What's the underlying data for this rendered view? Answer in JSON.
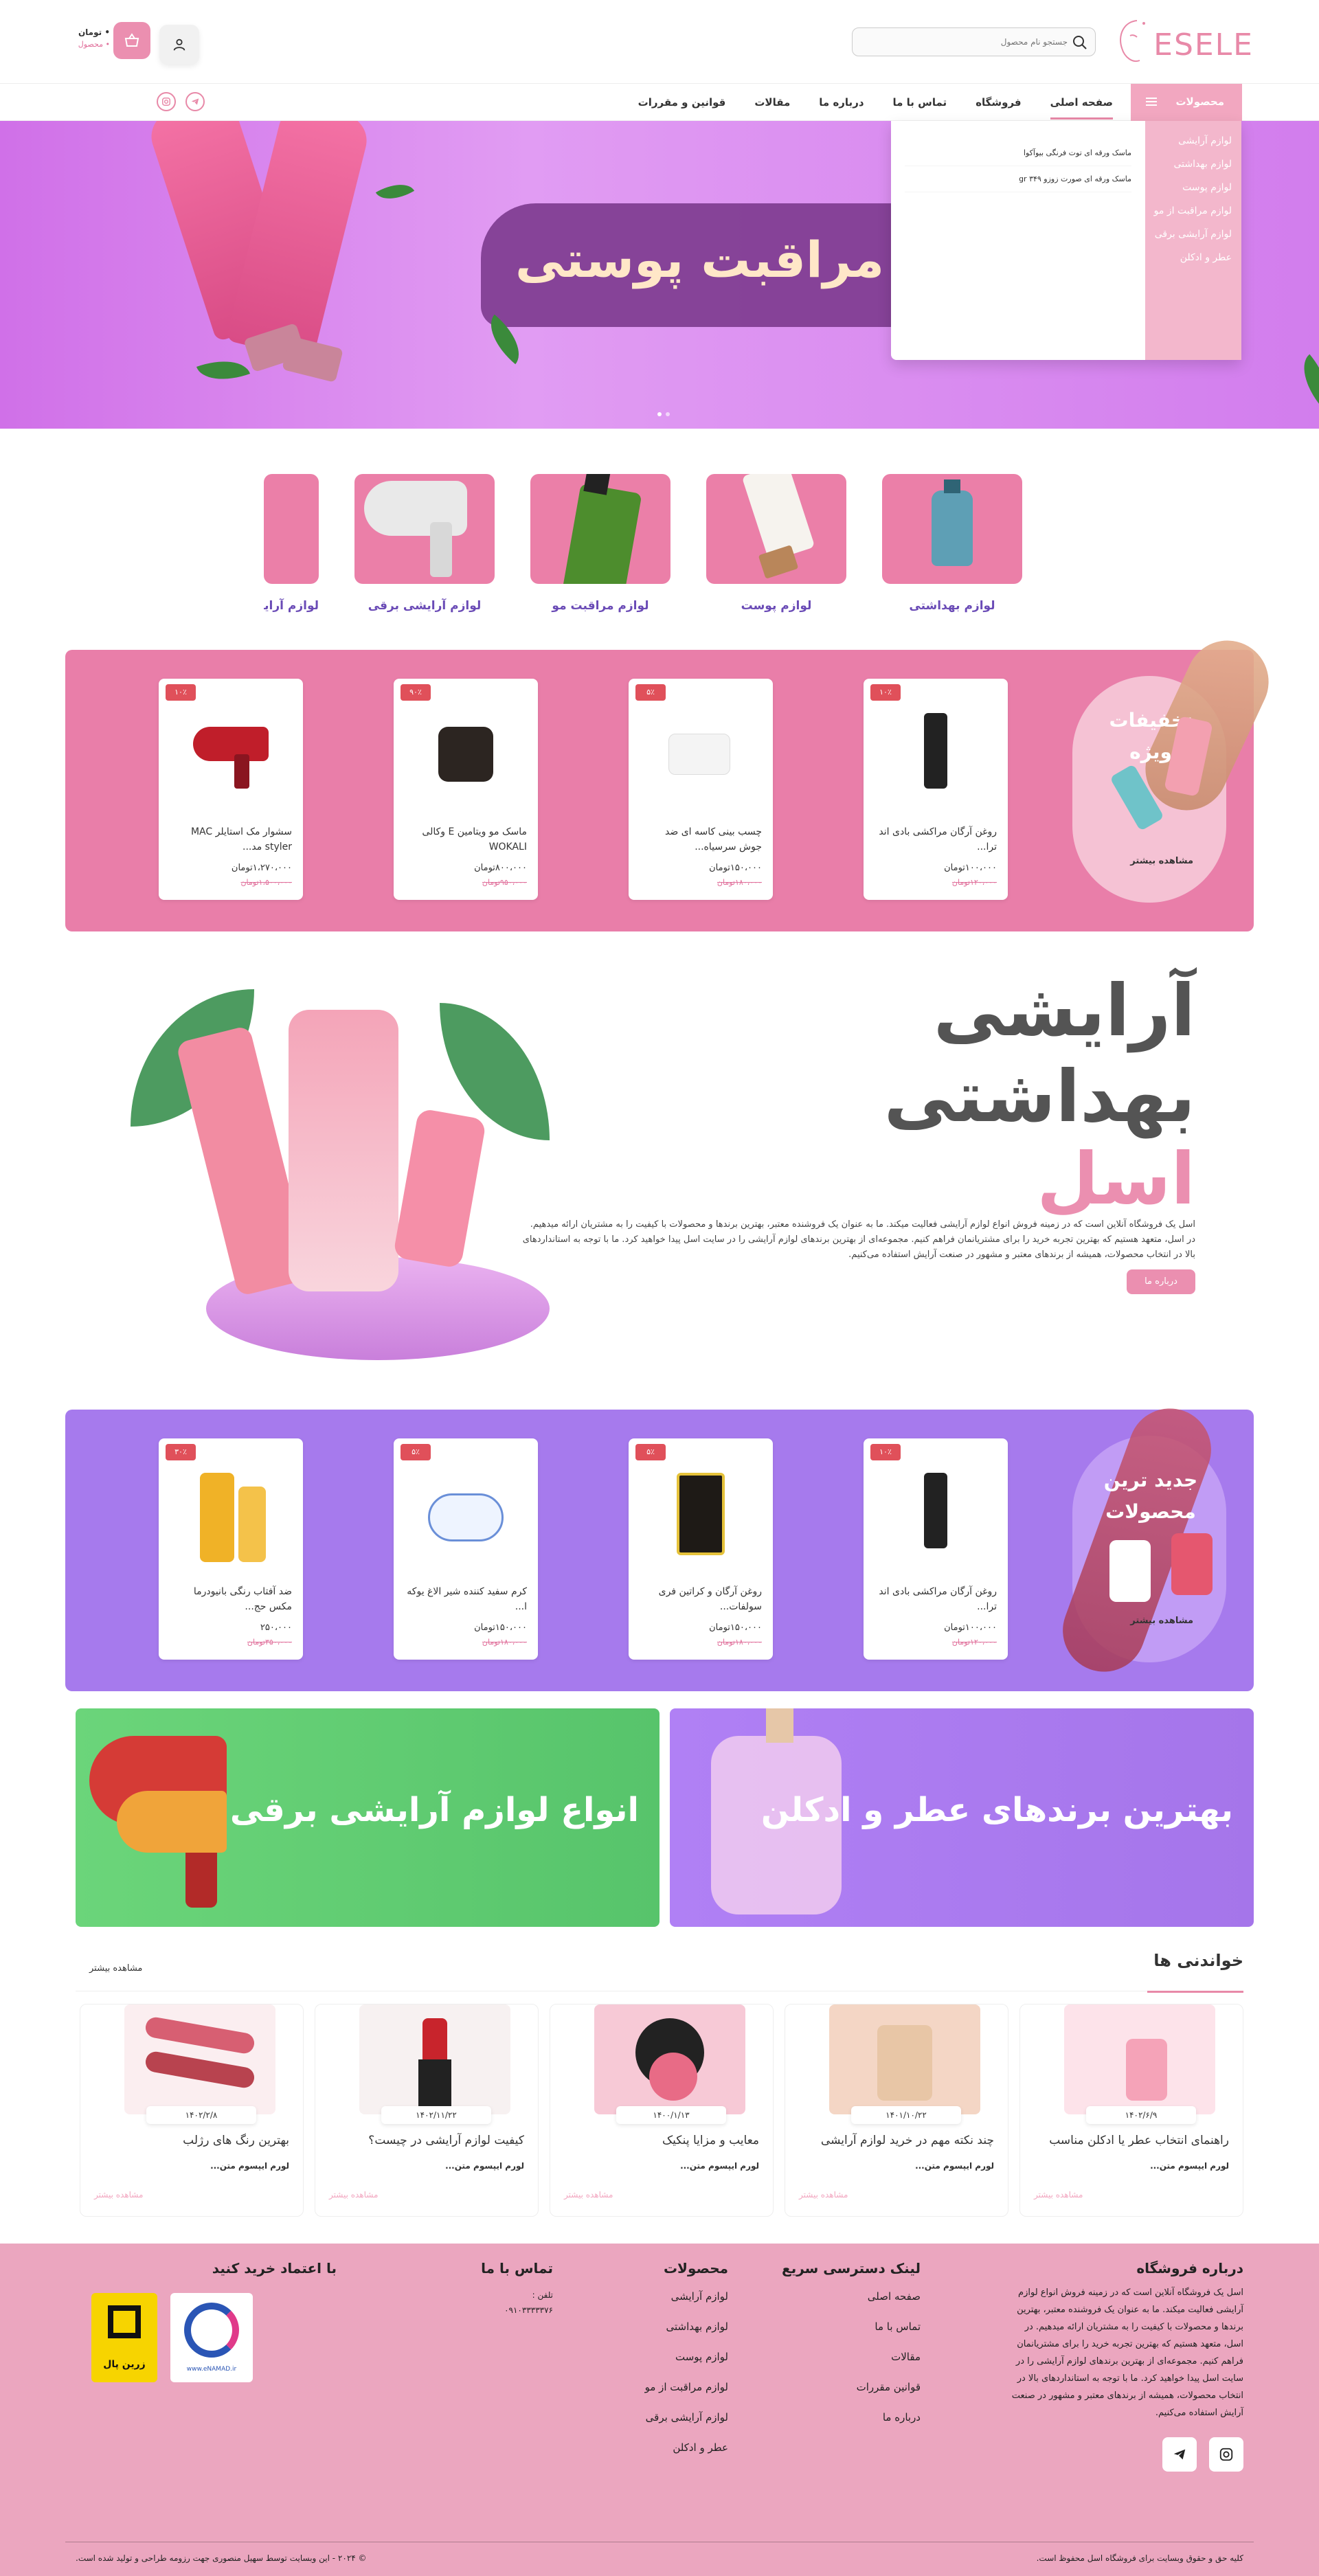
{
  "header": {
    "logo_text": "ESELE",
    "search_placeholder": "جستجو نام محصول",
    "cart_amount": "• تومان",
    "cart_count": "• محصول"
  },
  "nav": {
    "products_label": "محصولات",
    "links": [
      "صفحه اصلی",
      "فروشگاه",
      "تماس با ما",
      "درباره ما",
      "مقالات",
      "قوانین و مقررات"
    ]
  },
  "mega_menu": {
    "categories": [
      "لوازم آرایشی",
      "لوازم بهداشتی",
      "لوازم پوست",
      "لوازم مراقبت از مو",
      "لوازم آرایشی برقی",
      "عطر و ادکلن"
    ],
    "items": [
      "ماسک ورقه ای توت فرنگی بیوآکوا",
      "ماسک ورقه ای صورت زوزو ۳۴۹ gr"
    ]
  },
  "hero": {
    "title": "محصولات مراقبت پوستی"
  },
  "categories": [
    "لوازم بهداشتی",
    "لوازم پوست",
    "لوازم مراقبت مو",
    "لوازم آرایشی برقی",
    "لوازم آرایشی"
  ],
  "special_offers": {
    "title_line1": "تخفیفات",
    "title_line2": "ویژه",
    "more": "مشاهده بیشتر",
    "products": [
      {
        "title": "روغن آرگان مراکشی بادی اند ترا...",
        "badge": "۱۰٪",
        "price": "۱۰۰،۰۰۰تومان",
        "old": "۱۲۰،۰۰۰تومان"
      },
      {
        "title": "چسب بینی کاسه ای ضد جوش سرسیاه...",
        "badge": "۵٪",
        "price": "۱۵۰،۰۰۰تومان",
        "old": "۱۸۰،۰۰۰تومان"
      },
      {
        "title": "ماسک مو ویتامین E وکالی WOKALI",
        "badge": "۹۰٪",
        "price": "۸۰۰،۰۰۰تومان",
        "old": "۹۵۰،۰۰۰تومان"
      },
      {
        "title": "سشوار مک استایلر MAC styler مد...",
        "badge": "۱۰٪",
        "price": "۱،۲۷۰،۰۰۰تومان",
        "old": "۱،۵۰۰،۰۰۰تومان"
      }
    ]
  },
  "about": {
    "line1": "آرایشی",
    "line2": "بهداشتی",
    "line3": "اسل",
    "text": "اسل یک فروشگاه آنلاین است که در زمینه فروش انواع لوازم آرایشی فعالیت میکند. ما به عنوان یک فروشنده معتبر، بهترین برندها و محصولات با کیفیت را به مشتریان ارائه میدهیم. در اسل، متعهد هستیم که بهترین تجربه خرید را برای مشتریانمان فراهم کنیم. مجموعه‌ای از بهترین برندهای لوازم آرایشی را در سایت اسل پیدا خواهید کرد. ما با توجه به استانداردهای بالا در انتخاب محصولات، همیشه از برندهای معتبر و مشهور در صنعت آرایش استفاده می‌کنیم.",
    "button": "درباره ما"
  },
  "new_products": {
    "title_line1": "جدید ترین",
    "title_line2": "محصولات",
    "more": "مشاهده بیشتر",
    "products": [
      {
        "title": "روغن آرگان مراکشی بادی اند ترا...",
        "badge": "۱۰٪",
        "price": "۱۰۰،۰۰۰تومان",
        "old": "۱۲۰،۰۰۰تومان"
      },
      {
        "title": "روغن آرگان و کراتین فری سولفات...",
        "badge": "۵٪",
        "price": "۱۵۰،۰۰۰تومان",
        "old": "۱۸۰،۰۰۰تومان"
      },
      {
        "title": "کرم سفید کننده شیر الاغ یوکه ا...",
        "badge": "۵٪",
        "price": "۱۵۰،۰۰۰تومان",
        "old": "۱۸۰،۰۰۰تومان"
      },
      {
        "title": "ضد آفتاب رنگی بانیودرما مکس حج...",
        "badge": "۳۰٪",
        "price": "۲۵۰،۰۰۰",
        "old": "۳۵۰،۰۰۰تومان"
      }
    ]
  },
  "banners": {
    "left": "انواع لوازم آرایشی برقی",
    "right": "بهترین برندهای عطر و ادکلن"
  },
  "blog": {
    "title": "خواندنی ها",
    "more": "مشاهده بیشتر",
    "posts": [
      {
        "title": "راهنمای انتخاب عطر یا ادکلن مناسب",
        "date": "۱۴۰۲/۶/۹",
        "excerpt": "لورم ایپسوم متن...",
        "more": "مشاهده بیشتر"
      },
      {
        "title": "چند نکته مهم در خرید لوازم آرایشی",
        "date": "۱۴۰۱/۱۰/۲۲",
        "excerpt": "لورم ایپسوم متن...",
        "more": "مشاهده بیشتر"
      },
      {
        "title": "معایب و مزایا پنکیک",
        "date": "۱۴۰۰/۱/۱۳",
        "excerpt": "لورم ایپسوم متن...",
        "more": "مشاهده بیشتر"
      },
      {
        "title": "کیفیت لوازم آرایشی در چیست؟",
        "date": "۱۴۰۲/۱۱/۲۲",
        "excerpt": "لورم ایپسوم متن...",
        "more": "مشاهده بیشتر"
      },
      {
        "title": "بهترین رنگ های رژلب",
        "date": "۱۴۰۲/۲/۸",
        "excerpt": "لورم ایپسوم متن...",
        "more": "مشاهده بیشتر"
      }
    ]
  },
  "footer": {
    "about_title": "درباره فروشگاه",
    "about_text": "اسل یک فروشگاه آنلاین است که در زمینه فروش انواع لوازم آرایشی فعالیت میکند. ما به عنوان یک فروشنده معتبر، بهترین برندها و محصولات با کیفیت را به مشتریان ارائه میدهیم. در اسل، متعهد هستیم که بهترین تجربه خرید را برای مشتریانمان فراهم کنیم. مجموعه‌ای از بهترین برندهای لوازم آرایشی را در سایت اسل پیدا خواهید کرد. ما با توجه به استانداردهای بالا در انتخاب محصولات، همیشه از برندهای معتبر و مشهور در صنعت آرایش استفاده می‌کنیم.",
    "quick_title": "لینک دسترسی سریع",
    "quick_links": [
      "صفحه اصلی",
      "تماس با ما",
      "مقالات",
      "قوانین مقررات",
      "درباره ما"
    ],
    "products_title": "محصولات",
    "product_links": [
      "لوازم آرایشی",
      "لوازم بهداشتی",
      "لوازم پوست",
      "لوازم مراقبت از مو",
      "لوازم آرایشی برقی",
      "عطر و ادکلن"
    ],
    "contact_title": "تماس با ما",
    "phone_label": "تلفن :",
    "phone": "۰۹۱۰۳۳۳۳۳۷۶",
    "trust_title": "با اعتماد خرید کنید",
    "enamad_text": "www.eNAMAD.ir",
    "zarinpal_text": "زرین پال",
    "copyright_right": "کلیه حق و حقوق وبسایت برای فروشگاه اسل محفوظ است.",
    "copyright_left": "© ۲۰۲۴ - این وبسایت توسط سهیل منصوری جهت رزومه طراحی و تولید شده است."
  }
}
